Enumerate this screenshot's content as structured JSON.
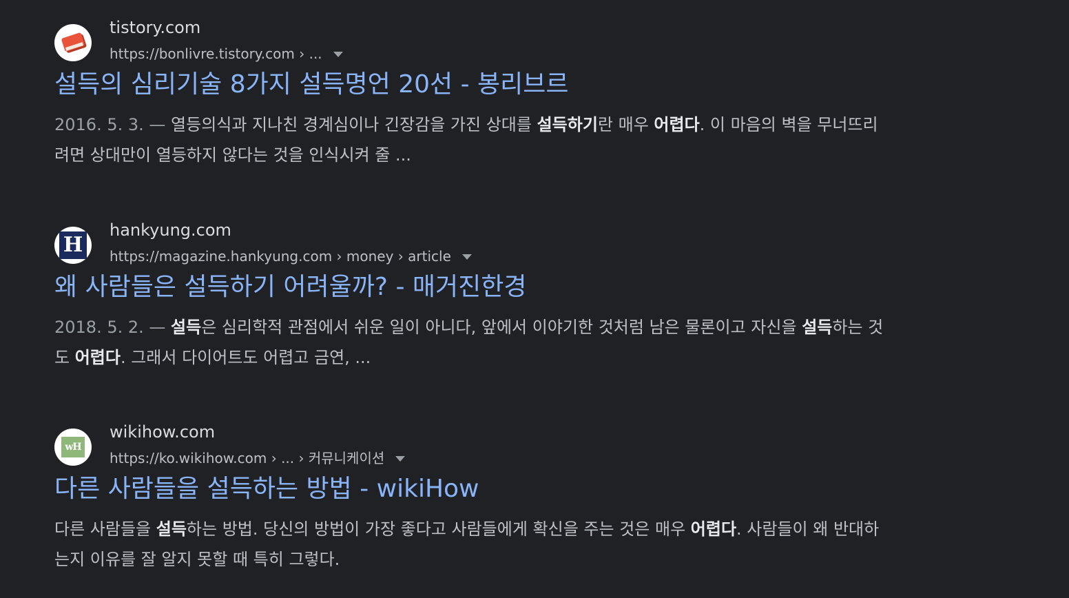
{
  "results": [
    {
      "favicon": "book-icon",
      "site_name": "tistory.com",
      "url": "https://bonlivre.tistory.com › ...",
      "title": "설득의 심리기술 8가지 설득명언 20선 - 봉리브르",
      "date": "2016. 5. 3. — ",
      "snippet_parts": [
        {
          "t": "열등의식과 지나친 경계심이나 긴장감을 가진 상대를 ",
          "b": false
        },
        {
          "t": "설득하기",
          "b": true
        },
        {
          "t": "란 매우 ",
          "b": false
        },
        {
          "t": "어렵다",
          "b": true
        },
        {
          "t": ". 이 마음의 벽을 무너뜨리려면 상대만이 열등하지 않다는 것을 인식시켜 줄 ...",
          "b": false
        }
      ]
    },
    {
      "favicon": "h-logo-icon",
      "favicon_text": "H",
      "site_name": "hankyung.com",
      "url": "https://magazine.hankyung.com › money › article",
      "title": "왜 사람들은 설득하기 어려울까? - 매거진한경",
      "date": "2018. 5. 2. — ",
      "snippet_parts": [
        {
          "t": "설득",
          "b": true
        },
        {
          "t": "은 심리학적 관점에서 쉬운 일이 아니다, 앞에서 이야기한 것처럼 남은 물론이고 자신을 ",
          "b": false
        },
        {
          "t": "설득",
          "b": true
        },
        {
          "t": "하는 것도 ",
          "b": false
        },
        {
          "t": "어렵다",
          "b": true
        },
        {
          "t": ". 그래서 다이어트도 어렵고 금연, ...",
          "b": false
        }
      ]
    },
    {
      "favicon": "wikihow-icon",
      "favicon_text": "wH",
      "site_name": "wikihow.com",
      "url": "https://ko.wikihow.com › ... › 커뮤니케이션",
      "title": "다른 사람들을 설득하는 방법 - wikiHow",
      "date": "",
      "snippet_parts": [
        {
          "t": "다른 사람들을 ",
          "b": false
        },
        {
          "t": "설득",
          "b": true
        },
        {
          "t": "하는 방법. 당신의 방법이 가장 좋다고 사람들에게 확신을 주는 것은 매우 ",
          "b": false
        },
        {
          "t": "어렵다",
          "b": true
        },
        {
          "t": ". 사람들이 왜 반대하는지 이유를 잘 알지 못할 때 특히 그렇다.",
          "b": false
        }
      ]
    }
  ],
  "colors": {
    "background": "#202124",
    "title_link": "#8ab4f8",
    "site_name": "#dadce0",
    "url": "#bdc1c6",
    "snippet": "#bdc1c6",
    "bold": "#e8eaed"
  }
}
